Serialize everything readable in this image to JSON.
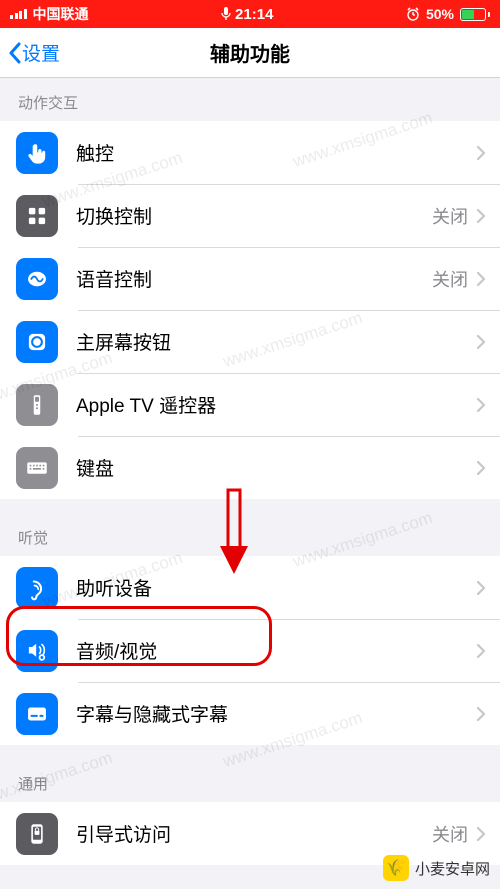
{
  "status": {
    "carrier": "中国联通",
    "time": "21:14",
    "battery_pct": "50%"
  },
  "nav": {
    "back": "设置",
    "title": "辅助功能"
  },
  "sections": {
    "motor": {
      "header": "动作交互",
      "touch": "触控",
      "switch_control": "切换控制",
      "switch_control_status": "关闭",
      "voice_control": "语音控制",
      "voice_control_status": "关闭",
      "home_button": "主屏幕按钮",
      "apple_tv_remote": "Apple TV 遥控器",
      "keyboard": "键盘"
    },
    "hearing": {
      "header": "听觉",
      "hearing_devices": "助听设备",
      "audio_visual": "音频/视觉",
      "subtitles": "字幕与隐藏式字幕"
    },
    "general": {
      "header": "通用",
      "guided_access": "引导式访问",
      "guided_access_status": "关闭"
    }
  },
  "watermark": "www.xmsigma.com",
  "brand": "小麦安卓网"
}
